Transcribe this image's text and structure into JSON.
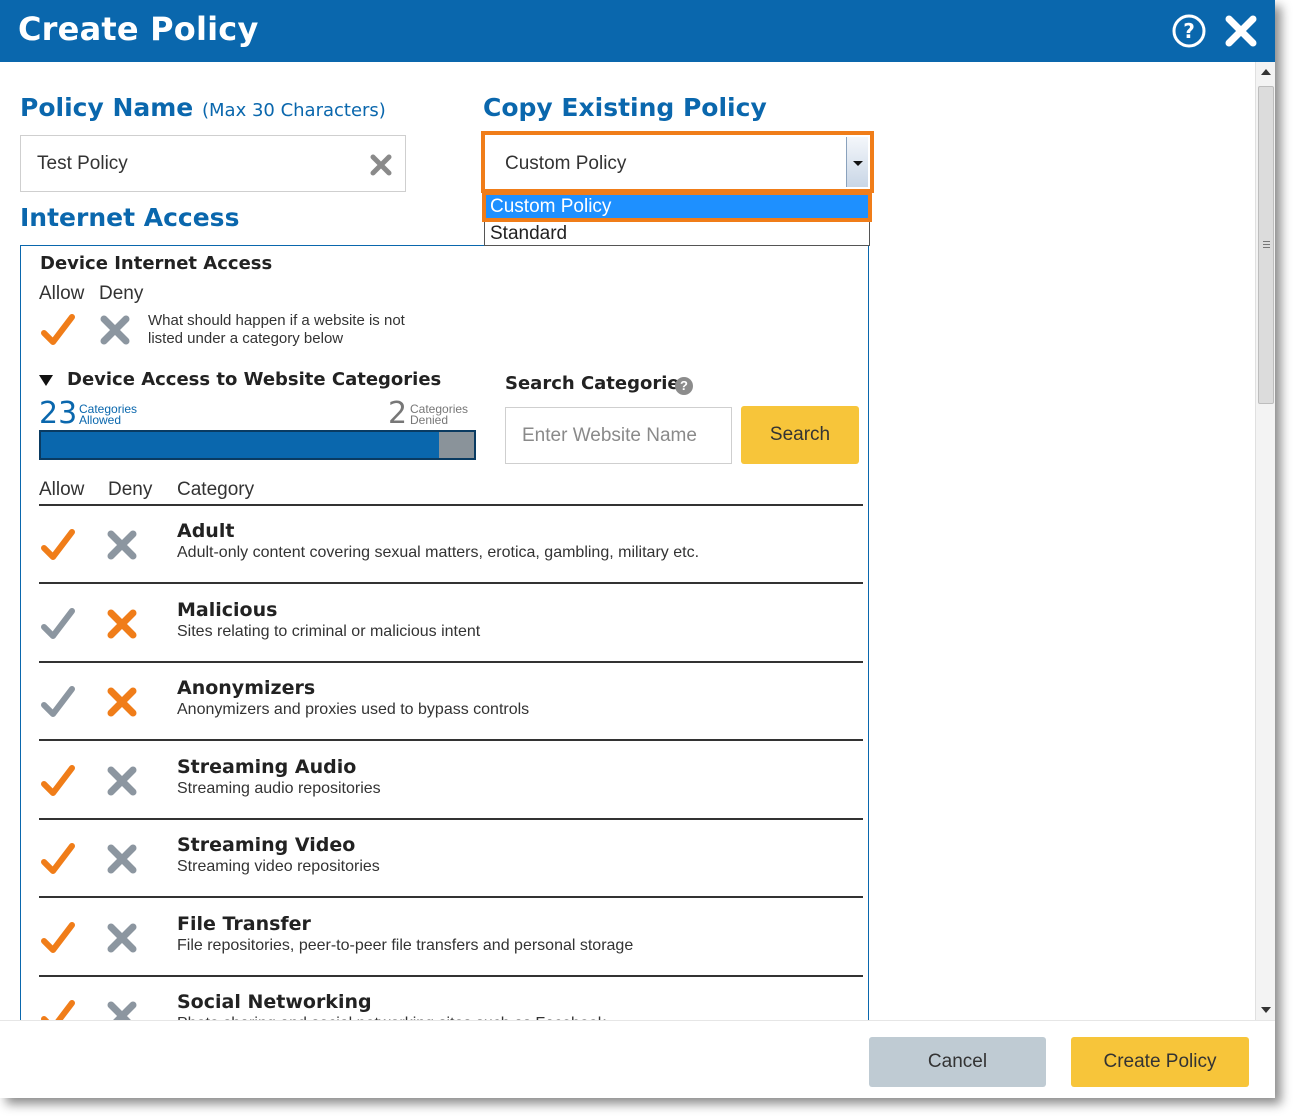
{
  "dialog": {
    "title": "Create Policy",
    "help_icon": "help-circle-icon",
    "close_icon": "close-icon"
  },
  "policy_name": {
    "label": "Policy Name",
    "hint": "(Max 30 Characters)",
    "value": "Test Policy",
    "clear_icon": "clear-x-icon"
  },
  "copy_policy": {
    "label": "Copy Existing Policy",
    "selected": "Custom Policy",
    "options": [
      "Custom Policy",
      "Standard"
    ]
  },
  "internet_access": {
    "label": "Internet Access",
    "device": {
      "title": "Device Internet Access",
      "allow_label": "Allow",
      "deny_label": "Deny",
      "note": "What should happen if a website is not listed under a category below",
      "state": "allow"
    },
    "categories_section": {
      "title": "Device Access to Website Categories",
      "allowed_count": "23",
      "allowed_label_1": "Categories",
      "allowed_label_2": "Allowed",
      "denied_count": "2",
      "denied_label_1": "Categories",
      "denied_label_2": "Denied",
      "allowed_fraction": 0.92
    },
    "search": {
      "label": "Search Categories",
      "placeholder": "Enter Website Name",
      "button": "Search"
    },
    "table": {
      "col_allow": "Allow",
      "col_deny": "Deny",
      "col_category": "Category",
      "rows": [
        {
          "name": "Adult",
          "desc": "Adult-only content covering sexual matters, erotica, gambling, military etc.",
          "state": "allow"
        },
        {
          "name": "Malicious",
          "desc": "Sites relating to criminal or malicious intent",
          "state": "deny"
        },
        {
          "name": "Anonymizers",
          "desc": "Anonymizers and proxies used to bypass controls",
          "state": "deny"
        },
        {
          "name": "Streaming Audio",
          "desc": "Streaming audio repositories",
          "state": "allow"
        },
        {
          "name": "Streaming Video",
          "desc": "Streaming video repositories",
          "state": "allow"
        },
        {
          "name": "File Transfer",
          "desc": "File repositories, peer-to-peer file transfers and personal storage",
          "state": "allow"
        },
        {
          "name": "Social Networking",
          "desc": "Photo sharing and social networking sites such as Facebook",
          "state": "allow"
        }
      ]
    }
  },
  "footer": {
    "cancel": "Cancel",
    "create": "Create Policy"
  },
  "colors": {
    "brand_blue": "#0a67ad",
    "active_orange": "#f07d19",
    "inactive_gray": "#8c96a0",
    "button_yellow": "#f7c53a"
  }
}
